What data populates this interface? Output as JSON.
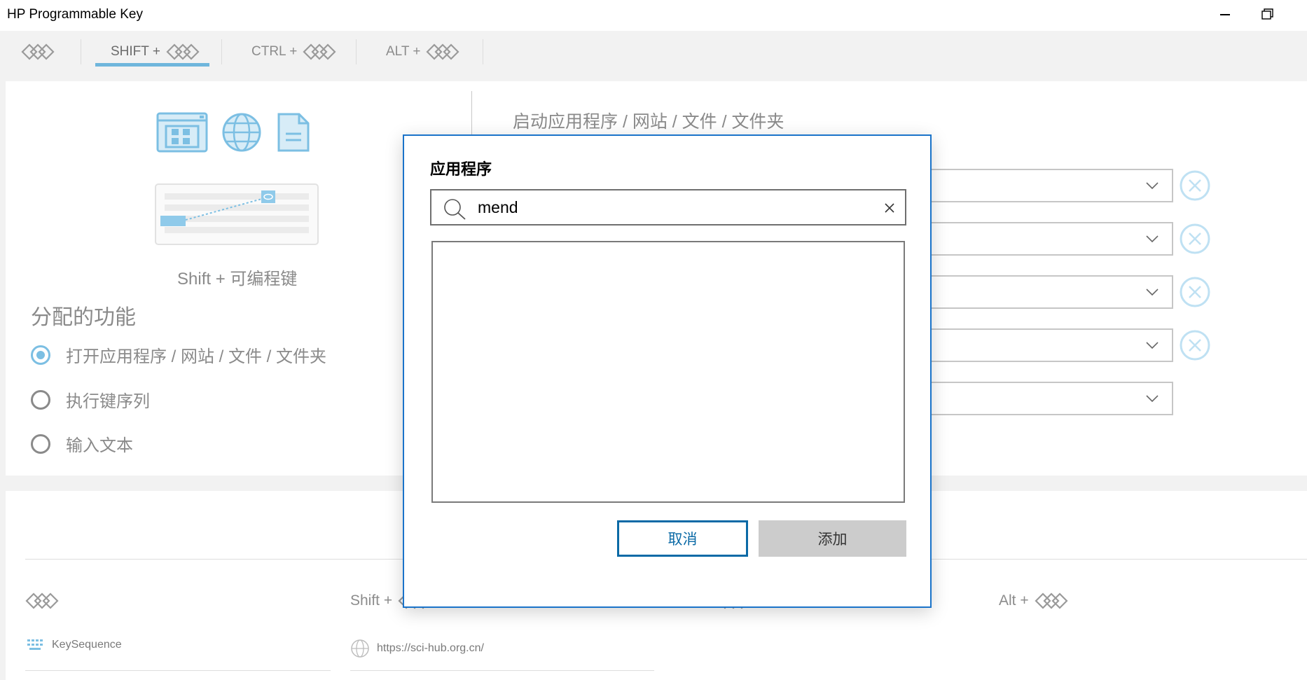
{
  "window": {
    "title": "HP Programmable Key",
    "minimize_icon": "minimize-icon",
    "restore_icon": "restore-icon"
  },
  "tabs": [
    {
      "label": "",
      "icon": "programmable-key-icon",
      "active": false
    },
    {
      "label": "SHIFT +",
      "icon": "programmable-key-icon",
      "active": true
    },
    {
      "label": "CTRL +",
      "icon": "programmable-key-icon",
      "active": false
    },
    {
      "label": "ALT +",
      "icon": "programmable-key-icon",
      "active": false
    }
  ],
  "config": {
    "illustration_caption": "Shift + 可编程键",
    "function_heading": "分配的功能",
    "options": [
      {
        "label": "打开应用程序 / 网站 / 文件 / 文件夹",
        "checked": true
      },
      {
        "label": "执行键序列",
        "checked": false
      },
      {
        "label": "输入文本",
        "checked": false
      }
    ],
    "right_title": "启动应用程序 / 网站 / 文件 / 文件夹",
    "launch_slots": [
      {
        "value": "",
        "removable": true
      },
      {
        "value": "",
        "removable": true
      },
      {
        "value": "",
        "removable": true
      },
      {
        "value": "",
        "removable": true
      },
      {
        "value": "",
        "removable": false
      }
    ]
  },
  "summary": {
    "columns": [
      {
        "heading": "",
        "item": "KeySequence",
        "item_icon": "keyboard-icon"
      },
      {
        "heading": "Shift +",
        "item": "https://sci-hub.org.cn/",
        "item_icon": "globe-icon"
      },
      {
        "heading": "",
        "item": "",
        "item_icon": ""
      },
      {
        "heading": "Alt +",
        "item": "",
        "item_icon": ""
      }
    ]
  },
  "dialog": {
    "title": "应用程序",
    "search": {
      "value": "mend",
      "placeholder": ""
    },
    "results": [],
    "cancel_label": "取消",
    "add_label": "添加"
  },
  "colors": {
    "accent": "#6fb6dc",
    "dialog_border": "#1a73c9",
    "primary_button": "#0b6aa6",
    "disabled_button": "#cccccc"
  }
}
